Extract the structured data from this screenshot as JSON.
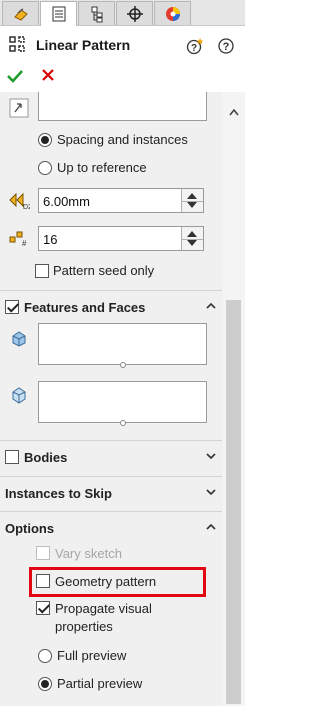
{
  "tabs": [
    {
      "icon": "feature-manager-icon",
      "active": false
    },
    {
      "icon": "property-manager-icon",
      "active": true
    },
    {
      "icon": "configuration-manager-icon",
      "active": false
    },
    {
      "icon": "dimxpert-manager-icon",
      "active": false
    },
    {
      "icon": "display-manager-icon",
      "active": false
    }
  ],
  "header": {
    "title": "Linear Pattern",
    "feature_icon": "linear-pattern-icon"
  },
  "direction": {
    "spacing_label": "Spacing and instances",
    "up_to_label": "Up to reference",
    "selected": "spacing",
    "spacing_value": "6.00mm",
    "instances_value": "16",
    "seed_only_label": "Pattern seed only",
    "seed_only_checked": false
  },
  "features_faces": {
    "title": "Features and Faces",
    "checked": true,
    "expanded": true
  },
  "bodies": {
    "title": "Bodies",
    "checked": false,
    "expanded": false
  },
  "instances_to_skip": {
    "title": "Instances to Skip",
    "expanded": false
  },
  "options": {
    "title": "Options",
    "expanded": true,
    "vary_sketch_label": "Vary sketch",
    "vary_sketch_enabled": false,
    "geometry_pattern_label": "Geometry pattern",
    "geometry_pattern_checked": false,
    "propagate_label_line1": "Propagate visual",
    "propagate_label_line2": "properties",
    "propagate_checked": true,
    "full_preview_label": "Full preview",
    "partial_preview_label": "Partial preview",
    "preview_selected": "partial"
  },
  "colors": {
    "highlight": "#e30613",
    "ok_green": "#1f9b2b",
    "cancel_red": "#d60000"
  }
}
